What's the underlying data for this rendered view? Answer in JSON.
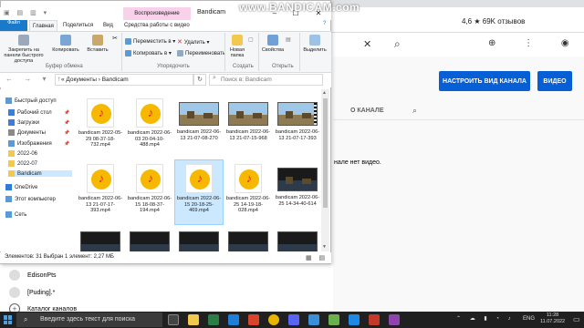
{
  "watermark": "www.BANDICAM.com",
  "browser": {
    "reviews": "4,6 ★ 69K отзывов",
    "yt": {
      "customize_button": "НАСТРОИТЬ ВИД КАНАЛА",
      "video_button": "ВИДЕО",
      "tab_about": "О КАНАЛЕ",
      "no_video_text": "нале нет видео.",
      "sidebar": [
        {
          "label": "EdisonPts"
        },
        {
          "label": "[Puding].*"
        },
        {
          "label": "Каталог каналов"
        }
      ]
    }
  },
  "explorer": {
    "title": "Bandicam",
    "context_tab": "Воспроизведение",
    "tabs": [
      "Файл",
      "Главная",
      "Поделиться",
      "Вид",
      "Средства работы с видео"
    ],
    "ribbon": {
      "pin_label": "Закрепить на панели быстрого доступа",
      "copy_label": "Копировать",
      "paste_label": "Вставить",
      "clipboard_group": "Буфер обмена",
      "move_to": "Переместить в ▾",
      "copy_to": "Копировать в ▾",
      "delete": "Удалить ▾",
      "rename": "Переименовать",
      "organize_group": "Упорядочить",
      "new_folder": "Новая папка",
      "create_group": "Создать",
      "properties": "Свойства",
      "open_group": "Открыть",
      "select": "Выделить",
      "select_group": ""
    },
    "breadcrumb": "«  Документы  ›  Bandicam",
    "search_placeholder": "Поиск в: Bandicam",
    "nav": [
      {
        "label": "Быстрый доступ",
        "pinned": false
      },
      {
        "label": "Рабочий стол",
        "pinned": true
      },
      {
        "label": "Загрузки",
        "pinned": true
      },
      {
        "label": "Документы",
        "pinned": true
      },
      {
        "label": "Изображения",
        "pinned": true
      },
      {
        "label": "2022-06",
        "pinned": false
      },
      {
        "label": "2022-07",
        "pinned": false
      },
      {
        "label": "Bandicam",
        "pinned": false
      },
      {
        "label": "OneDrive",
        "pinned": false
      },
      {
        "label": "Этот компьютер",
        "pinned": false
      },
      {
        "label": "Сеть",
        "pinned": false
      }
    ],
    "files": [
      {
        "name": "bandicam 2022-05-29 08-37-18-732.mp4",
        "kind": "music"
      },
      {
        "name": "bandicam 2022-06-03 20-04-10-488.mp4",
        "kind": "music"
      },
      {
        "name": "bandicam 2022-06-13 21-07-08-270",
        "kind": "video"
      },
      {
        "name": "bandicam 2022-06-13 21-07-15-968",
        "kind": "video"
      },
      {
        "name": "bandicam 2022-06-13 21-07-17-393",
        "kind": "video-film"
      },
      {
        "name": "bandicam 2022-06-13 21-07-17-393.mp4",
        "kind": "music"
      },
      {
        "name": "bandicam 2022-06-15 18-08-37-194.mp4",
        "kind": "music"
      },
      {
        "name": "bandicam 2022-06-15 20-18-25-469.mp4",
        "kind": "music",
        "selected": true
      },
      {
        "name": "bandicam 2022-06-25 14-19-18-028.mp4",
        "kind": "music"
      },
      {
        "name": "bandicam 2022-06-25 14-34-40-614",
        "kind": "video-dark"
      }
    ],
    "status": "Элементов: 31    Выбран 1 элемент: 2,27 МБ"
  },
  "taskbar": {
    "search_placeholder": "Введите здесь текст для поиска",
    "lang": "ENG",
    "time": "11:28",
    "date": "11.07.2022"
  }
}
